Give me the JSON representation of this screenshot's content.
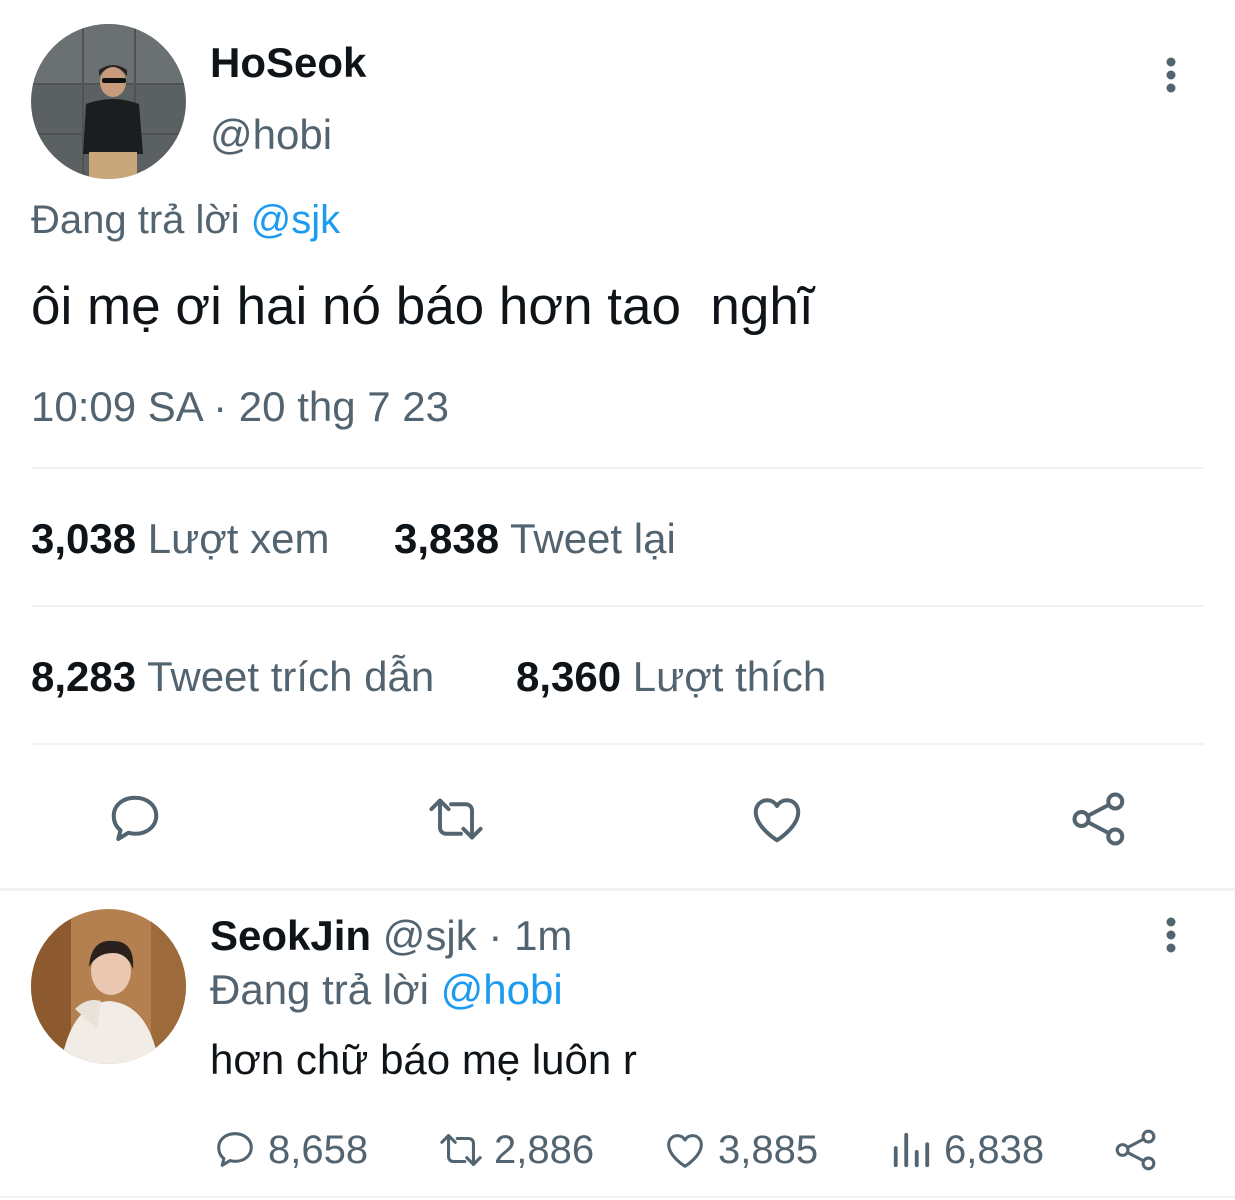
{
  "main_tweet": {
    "author_name": "HoSeok",
    "author_handle": "@hobi",
    "replying_prefix": "Đang trả lời",
    "replying_to": "@sjk",
    "text": "ôi mẹ ơi hai nó báo hơn tao  nghĩ",
    "timestamp": "10:09 SA · 20 thg 7 23",
    "stats": {
      "views_count": "3,038",
      "views_label": "Lượt xem",
      "retweets_count": "3,838",
      "retweets_label": "Tweet lại",
      "quotes_count": "8,283",
      "quotes_label": "Tweet trích dẫn",
      "likes_count": "8,360",
      "likes_label": "Lượt thích"
    },
    "actions": [
      "reply-icon",
      "retweet-icon",
      "like-icon",
      "share-icon"
    ]
  },
  "reply_tweet": {
    "author_name": "SeokJin",
    "author_handle": "@sjk",
    "separator": "·",
    "time_ago": "1m",
    "replying_prefix": "Đang trả lời",
    "replying_to": "@hobi",
    "text": "hơn chữ báo mẹ luôn r",
    "replies": "8,658",
    "retweets": "2,886",
    "likes": "3,885",
    "views": "6,838"
  },
  "colors": {
    "accent": "#1d9bf0",
    "text": "#0f1419",
    "muted": "#536471",
    "divider": "#eff3f4"
  }
}
